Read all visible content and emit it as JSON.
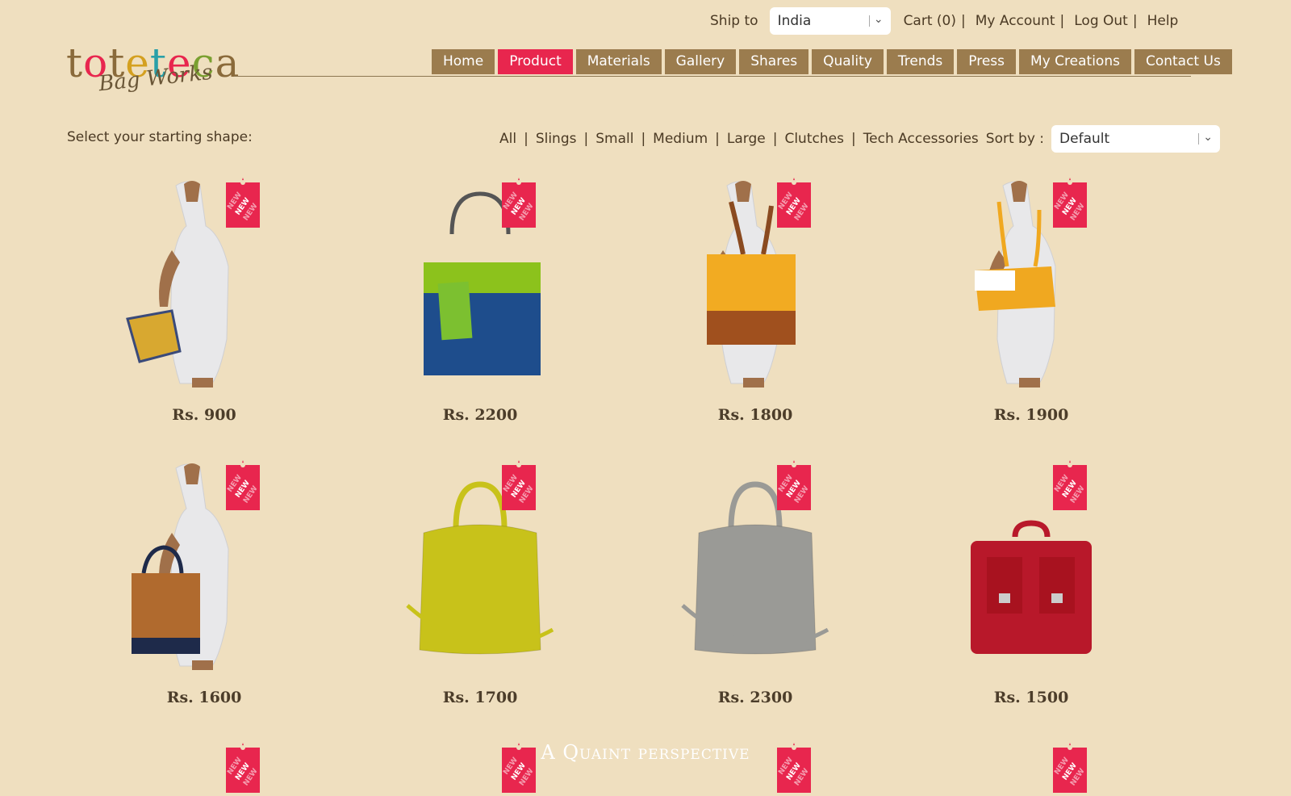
{
  "header": {
    "ship_to_label": "Ship to",
    "country": "India",
    "cart": "Cart (0)",
    "my_account": "My Account",
    "log_out": "Log Out",
    "help": "Help"
  },
  "logo": {
    "letters": [
      "t",
      "o",
      "t",
      "e",
      "t",
      "e",
      "c",
      "a"
    ],
    "colors": [
      "#8a6a3a",
      "#e8264e",
      "#8a6a3a",
      "#d4a020",
      "#2aa0a8",
      "#e8264e",
      "#7aa030",
      "#8a6a3a"
    ],
    "sub": "Bag Works"
  },
  "nav": [
    "Home",
    "Product",
    "Materials",
    "Gallery",
    "Shares",
    "Quality",
    "Trends",
    "Press",
    "My Creations",
    "Contact Us"
  ],
  "nav_active": "Product",
  "filter": {
    "label": "Select your starting shape:",
    "options": [
      "All",
      "Slings",
      "Small",
      "Medium",
      "Large",
      "Clutches",
      "Tech Accessories"
    ],
    "sort_label": "Sort by :",
    "sort_value": "Default"
  },
  "tag_text": "NEW",
  "products": [
    {
      "price": "Rs. 900",
      "bag": "clutch-on-model",
      "color": "#d8a830"
    },
    {
      "price": "Rs. 2200",
      "bag": "tote",
      "color": "#1e4d8c"
    },
    {
      "price": "Rs. 1800",
      "bag": "tote-on-model",
      "color": "#f2ab22"
    },
    {
      "price": "Rs. 1900",
      "bag": "shoulder-on-model",
      "color": "#f0a820"
    },
    {
      "price": "Rs. 1600",
      "bag": "handbag-on-model",
      "color": "#b06a2e"
    },
    {
      "price": "Rs. 1700",
      "bag": "duffel",
      "color": "#c8c21a"
    },
    {
      "price": "Rs. 2300",
      "bag": "duffel",
      "color": "#9a9a96"
    },
    {
      "price": "Rs. 1500",
      "bag": "satchel",
      "color": "#b8182a"
    }
  ],
  "footer_text": "A Quaint perspective",
  "colors": {
    "background": "#efdfbf",
    "nav": "#9b7c4e",
    "accent": "#e8264e"
  }
}
